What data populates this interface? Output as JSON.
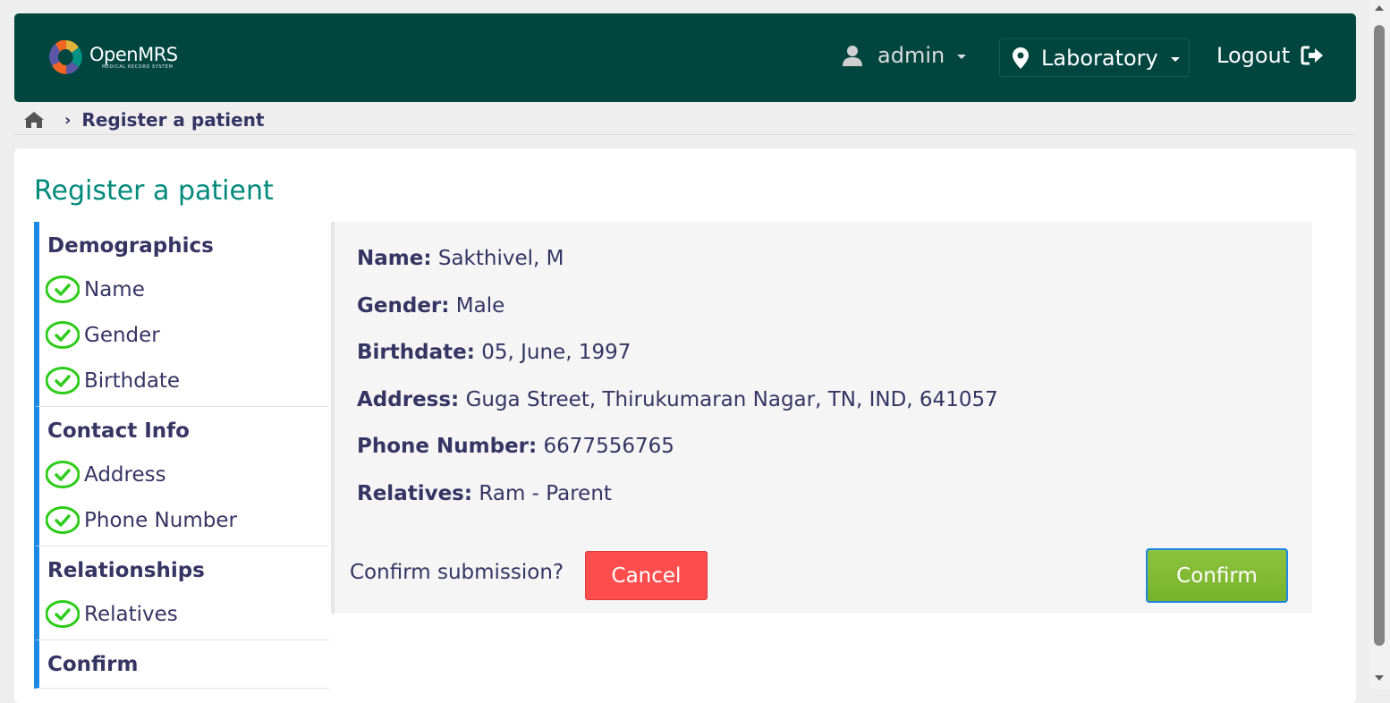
{
  "header": {
    "logo_text": "OpenMRS",
    "logo_subtext": "MEDICAL RECORD SYSTEM",
    "user_name": "admin",
    "location": "Laboratory",
    "logout_label": "Logout"
  },
  "breadcrumb": {
    "current": "Register a patient"
  },
  "page": {
    "title": "Register a patient"
  },
  "sidebar": {
    "sections": [
      {
        "title": "Demographics",
        "steps": [
          "Name",
          "Gender",
          "Birthdate"
        ]
      },
      {
        "title": "Contact Info",
        "steps": [
          "Address",
          "Phone Number"
        ]
      },
      {
        "title": "Relationships",
        "steps": [
          "Relatives"
        ]
      },
      {
        "title": "Confirm",
        "steps": []
      }
    ]
  },
  "summary": {
    "name_label": "Name:",
    "name_value": "Sakthivel, M",
    "gender_label": "Gender:",
    "gender_value": "Male",
    "birthdate_label": "Birthdate:",
    "birthdate_value": "05, June, 1997",
    "address_label": "Address:",
    "address_value": "Guga Street, Thirukumaran Nagar, TN, IND, 641057",
    "phone_label": "Phone Number:",
    "phone_value": "6677556765",
    "relatives_label": "Relatives:",
    "relatives_value": "Ram - Parent"
  },
  "actions": {
    "question": "Confirm submission?",
    "cancel_label": "Cancel",
    "confirm_label": "Confirm"
  },
  "colors": {
    "header_bg": "#00463f",
    "title_teal": "#00897b",
    "accent_blue": "#1e88e5",
    "cancel_red": "#ff4d4d",
    "confirm_green": "#82bb33",
    "check_green": "#2ecc1a"
  }
}
